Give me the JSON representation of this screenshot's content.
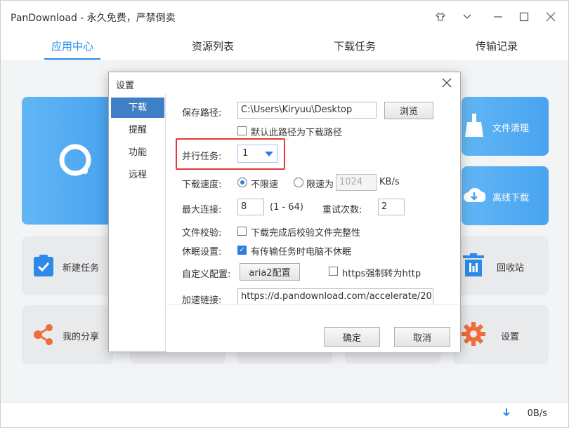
{
  "window": {
    "title": "PanDownload - 永久免费，严禁倒卖"
  },
  "tabs": [
    {
      "label": "应用中心"
    },
    {
      "label": "资源列表"
    },
    {
      "label": "下载任务"
    },
    {
      "label": "传输记录"
    }
  ],
  "tiles": {
    "file_clean": "文件清理",
    "offline_download": "离线下载",
    "new_task": "新建任务",
    "recycle_bin": "回收站",
    "my_share": "我的分享",
    "settings": "设置"
  },
  "status": {
    "speed": "0B/s"
  },
  "dialog": {
    "title": "设置",
    "sidebar": [
      {
        "label": "下载"
      },
      {
        "label": "提醒"
      },
      {
        "label": "功能"
      },
      {
        "label": "远程"
      }
    ],
    "save_path": {
      "label": "保存路径:",
      "value": "C:\\Users\\Kiryuu\\Desktop",
      "browse": "浏览"
    },
    "default_path": {
      "label": "默认此路径为下载路径",
      "checked": false
    },
    "parallel": {
      "label": "并行任务:",
      "value": "1"
    },
    "speed": {
      "label": "下载速度:",
      "unlimited": "不限速",
      "limit": "限速为",
      "limit_value": "1024",
      "unit": "KB/s"
    },
    "max_conn": {
      "label": "最大连接:",
      "value": "8",
      "range": "(1 - 64)"
    },
    "retry": {
      "label": "重试次数:",
      "value": "2"
    },
    "verify": {
      "label": "文件校验:",
      "option": "下载完成后校验文件完整性",
      "checked": false
    },
    "sleep": {
      "label": "休眠设置:",
      "option": "有传输任务时电脑不休眠",
      "checked": true
    },
    "custom": {
      "label": "自定义配置:",
      "button": "aria2配置",
      "https_option": "https强制转为http",
      "https_checked": false
    },
    "accel": {
      "label": "加速链接:",
      "value": "https://d.pandownload.com/accelerate/20..."
    },
    "ok": "确定",
    "cancel": "取消"
  },
  "colors": {
    "accent": "#2d8ae8",
    "highlight": "#e53935",
    "tile_blue": "#4aa4f0"
  }
}
